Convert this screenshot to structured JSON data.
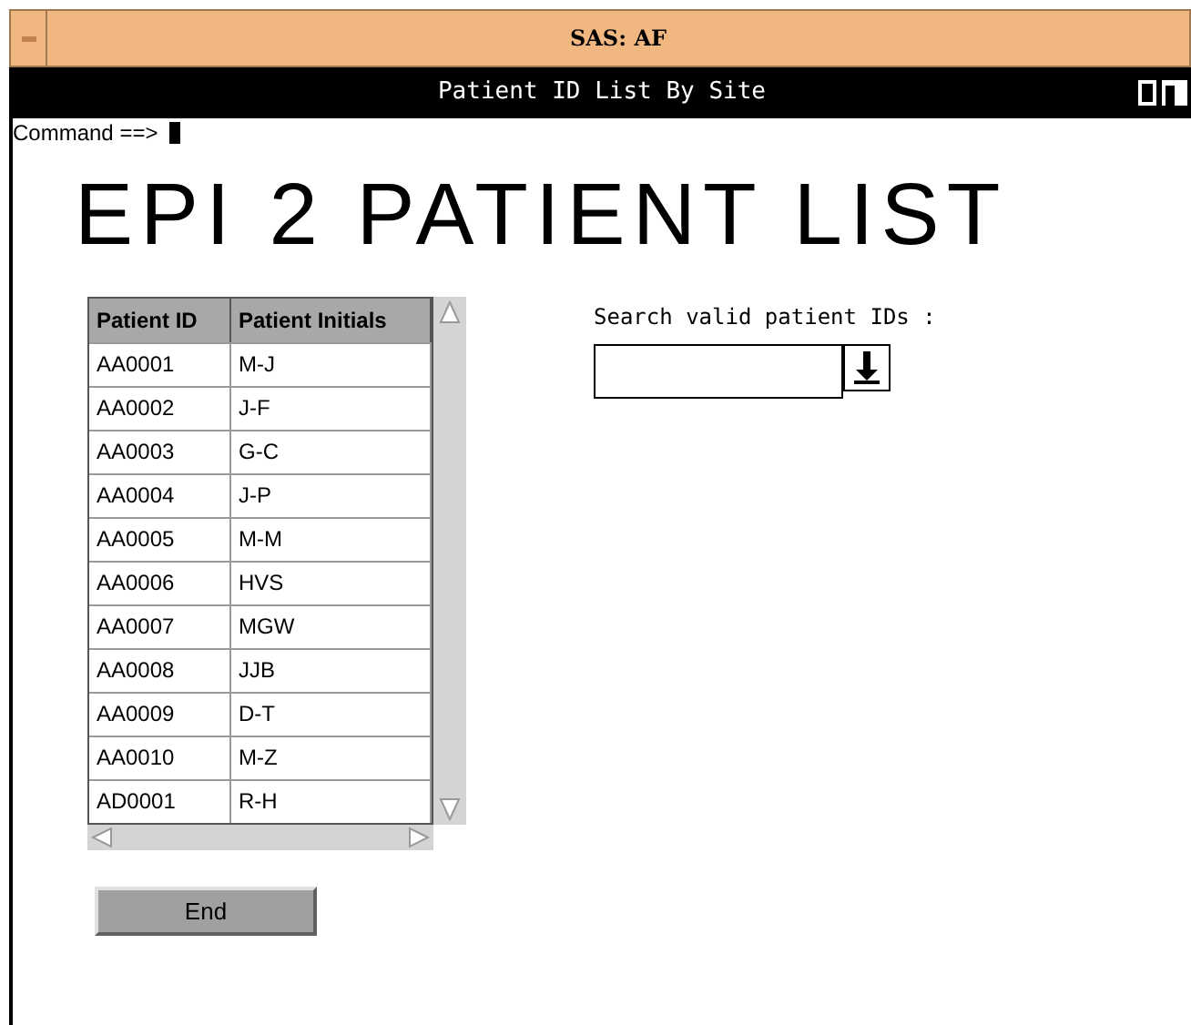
{
  "window": {
    "title": "SAS: AF"
  },
  "banner": {
    "title": "Patient ID List By Site"
  },
  "command": {
    "label": "Command ==>"
  },
  "heading": "EPI 2 PATIENT LIST",
  "table": {
    "columns": [
      "Patient ID",
      "Patient Initials"
    ],
    "rows": [
      [
        "AA0001",
        "M-J"
      ],
      [
        "AA0002",
        "J-F"
      ],
      [
        "AA0003",
        "G-C"
      ],
      [
        "AA0004",
        "J-P"
      ],
      [
        "AA0005",
        "M-M"
      ],
      [
        "AA0006",
        "HVS"
      ],
      [
        "AA0007",
        "MGW"
      ],
      [
        "AA0008",
        "JJB"
      ],
      [
        "AA0009",
        "D-T"
      ],
      [
        "AA0010",
        "M-Z"
      ],
      [
        "AD0001",
        "R-H"
      ]
    ]
  },
  "search": {
    "label": "Search valid patient IDs :"
  },
  "buttons": [
    "End"
  ]
}
